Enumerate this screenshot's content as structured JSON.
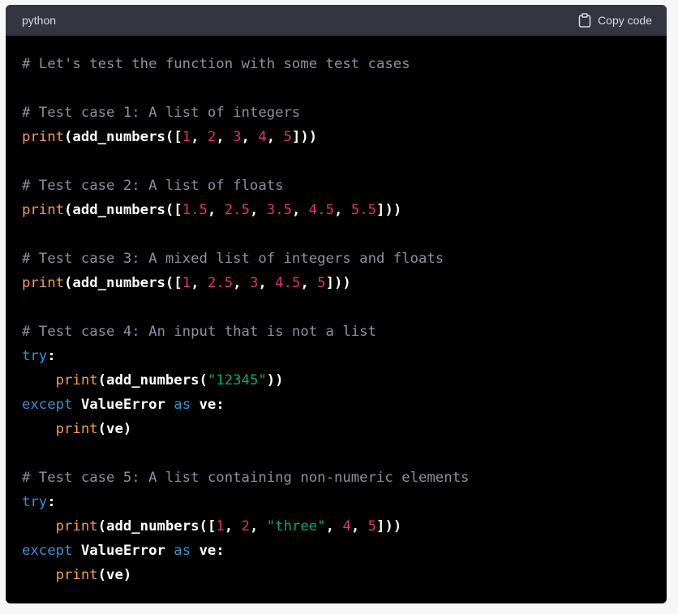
{
  "header": {
    "language": "python",
    "copy_label": "Copy code",
    "copy_icon": "clipboard-icon"
  },
  "colors": {
    "background": "#000000",
    "header": "#343541",
    "comment": "#8e8ea0",
    "function": "#f39c4a",
    "number": "#df3079",
    "string": "#00a67d",
    "keyword": "#2e95d3"
  },
  "code_lines": [
    [
      {
        "t": "c",
        "v": "# Let's test the function with some test cases"
      }
    ],
    [],
    [
      {
        "t": "c",
        "v": "# Test case 1: A list of integers"
      }
    ],
    [
      {
        "t": "f",
        "v": "print"
      },
      {
        "t": "p",
        "v": "(add_numbers(["
      },
      {
        "t": "n",
        "v": "1"
      },
      {
        "t": "p",
        "v": ", "
      },
      {
        "t": "n",
        "v": "2"
      },
      {
        "t": "p",
        "v": ", "
      },
      {
        "t": "n",
        "v": "3"
      },
      {
        "t": "p",
        "v": ", "
      },
      {
        "t": "n",
        "v": "4"
      },
      {
        "t": "p",
        "v": ", "
      },
      {
        "t": "n",
        "v": "5"
      },
      {
        "t": "p",
        "v": "]))"
      }
    ],
    [],
    [
      {
        "t": "c",
        "v": "# Test case 2: A list of floats"
      }
    ],
    [
      {
        "t": "f",
        "v": "print"
      },
      {
        "t": "p",
        "v": "(add_numbers(["
      },
      {
        "t": "n",
        "v": "1.5"
      },
      {
        "t": "p",
        "v": ", "
      },
      {
        "t": "n",
        "v": "2.5"
      },
      {
        "t": "p",
        "v": ", "
      },
      {
        "t": "n",
        "v": "3.5"
      },
      {
        "t": "p",
        "v": ", "
      },
      {
        "t": "n",
        "v": "4.5"
      },
      {
        "t": "p",
        "v": ", "
      },
      {
        "t": "n",
        "v": "5.5"
      },
      {
        "t": "p",
        "v": "]))"
      }
    ],
    [],
    [
      {
        "t": "c",
        "v": "# Test case 3: A mixed list of integers and floats"
      }
    ],
    [
      {
        "t": "f",
        "v": "print"
      },
      {
        "t": "p",
        "v": "(add_numbers(["
      },
      {
        "t": "n",
        "v": "1"
      },
      {
        "t": "p",
        "v": ", "
      },
      {
        "t": "n",
        "v": "2.5"
      },
      {
        "t": "p",
        "v": ", "
      },
      {
        "t": "n",
        "v": "3"
      },
      {
        "t": "p",
        "v": ", "
      },
      {
        "t": "n",
        "v": "4.5"
      },
      {
        "t": "p",
        "v": ", "
      },
      {
        "t": "n",
        "v": "5"
      },
      {
        "t": "p",
        "v": "]))"
      }
    ],
    [],
    [
      {
        "t": "c",
        "v": "# Test case 4: An input that is not a list"
      }
    ],
    [
      {
        "t": "k",
        "v": "try"
      },
      {
        "t": "p",
        "v": ":"
      }
    ],
    [
      {
        "t": "p",
        "v": "    "
      },
      {
        "t": "f",
        "v": "print"
      },
      {
        "t": "p",
        "v": "(add_numbers("
      },
      {
        "t": "s",
        "v": "\"12345\""
      },
      {
        "t": "p",
        "v": "))"
      }
    ],
    [
      {
        "t": "k",
        "v": "except"
      },
      {
        "t": "p",
        "v": " ValueError "
      },
      {
        "t": "k",
        "v": "as"
      },
      {
        "t": "p",
        "v": " ve:"
      }
    ],
    [
      {
        "t": "p",
        "v": "    "
      },
      {
        "t": "f",
        "v": "print"
      },
      {
        "t": "p",
        "v": "(ve)"
      }
    ],
    [],
    [
      {
        "t": "c",
        "v": "# Test case 5: A list containing non-numeric elements"
      }
    ],
    [
      {
        "t": "k",
        "v": "try"
      },
      {
        "t": "p",
        "v": ":"
      }
    ],
    [
      {
        "t": "p",
        "v": "    "
      },
      {
        "t": "f",
        "v": "print"
      },
      {
        "t": "p",
        "v": "(add_numbers(["
      },
      {
        "t": "n",
        "v": "1"
      },
      {
        "t": "p",
        "v": ", "
      },
      {
        "t": "n",
        "v": "2"
      },
      {
        "t": "p",
        "v": ", "
      },
      {
        "t": "s",
        "v": "\"three\""
      },
      {
        "t": "p",
        "v": ", "
      },
      {
        "t": "n",
        "v": "4"
      },
      {
        "t": "p",
        "v": ", "
      },
      {
        "t": "n",
        "v": "5"
      },
      {
        "t": "p",
        "v": "]))"
      }
    ],
    [
      {
        "t": "k",
        "v": "except"
      },
      {
        "t": "p",
        "v": " ValueError "
      },
      {
        "t": "k",
        "v": "as"
      },
      {
        "t": "p",
        "v": " ve:"
      }
    ],
    [
      {
        "t": "p",
        "v": "    "
      },
      {
        "t": "f",
        "v": "print"
      },
      {
        "t": "p",
        "v": "(ve)"
      }
    ]
  ]
}
